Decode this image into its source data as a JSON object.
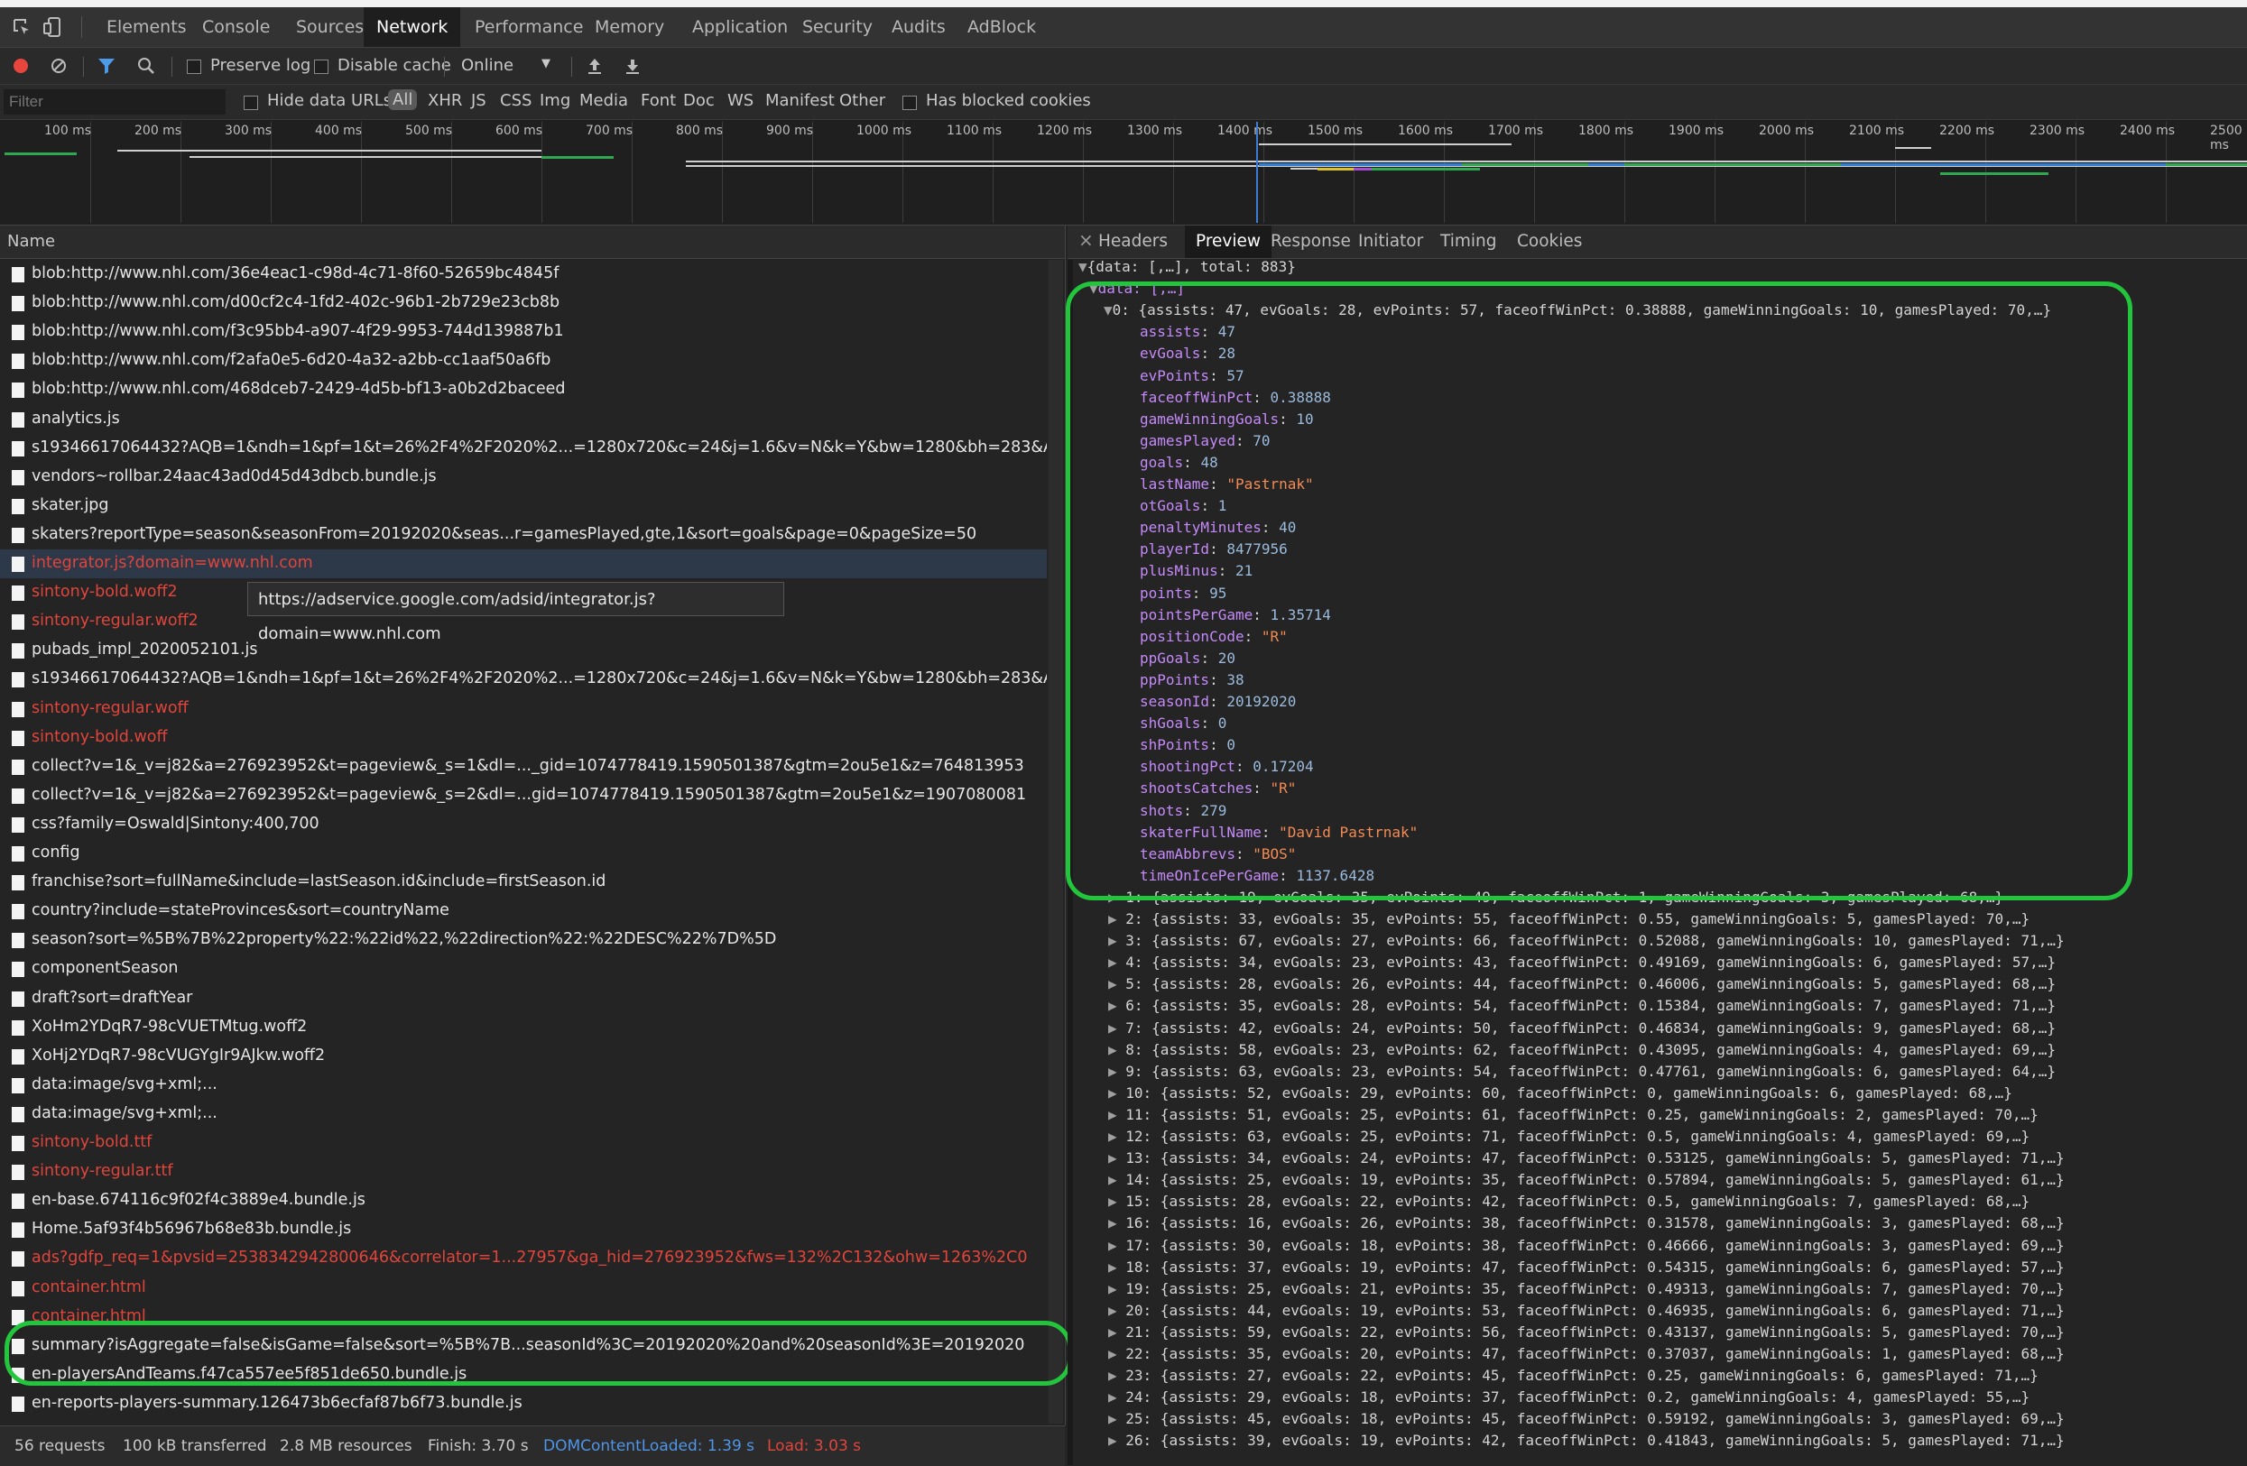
{
  "tabs": [
    "Elements",
    "Console",
    "Sources",
    "Network",
    "Performance",
    "Memory",
    "Application",
    "Security",
    "Audits",
    "AdBlock"
  ],
  "toolbar": {
    "preserve_log": "Preserve log",
    "disable_cache": "Disable cache",
    "throttle": "Online",
    "throttle_arrow": "▼"
  },
  "filterbar": {
    "placeholder": "Filter",
    "hide_data": "Hide data URLs",
    "types": [
      "All",
      "XHR",
      "JS",
      "CSS",
      "Img",
      "Media",
      "Font",
      "Doc",
      "WS",
      "Manifest",
      "Other"
    ],
    "blocked": "Has blocked cookies"
  },
  "timeline": [
    "100 ms",
    "200 ms",
    "300 ms",
    "400 ms",
    "500 ms",
    "600 ms",
    "700 ms",
    "800 ms",
    "900 ms",
    "1000 ms",
    "1100 ms",
    "1200 ms",
    "1300 ms",
    "1400 ms",
    "1500 ms",
    "1600 ms",
    "1700 ms",
    "1800 ms",
    "1900 ms",
    "2000 ms",
    "2100 ms",
    "2200 ms",
    "2300 ms",
    "2400 ms",
    "2500 ms"
  ],
  "list": {
    "header": "Name",
    "rows": [
      {
        "name": "blob:http://www.nhl.com/36e4eac1-c98d-4c71-8f60-52659bc4845f",
        "red": false
      },
      {
        "name": "blob:http://www.nhl.com/d00cf2c4-1fd2-402c-96b1-2b729e23cb8b",
        "red": false
      },
      {
        "name": "blob:http://www.nhl.com/f3c95bb4-a907-4f29-9953-744d139887b1",
        "red": false
      },
      {
        "name": "blob:http://www.nhl.com/f2afa0e5-6d20-4a32-a2bb-cc1aaf50a6fb",
        "red": false
      },
      {
        "name": "blob:http://www.nhl.com/468dceb7-2429-4d5b-bf13-a0b2d2baceed",
        "red": false
      },
      {
        "name": "analytics.js",
        "red": false
      },
      {
        "name": "s19346617064432?AQB=1&ndh=1&pf=1&t=26%2F4%2F2020%2...=1280x720&c=24&j=1.6&v=N&k=Y&bw=1280&bh=283&AQE=1",
        "red": false
      },
      {
        "name": "vendors~rollbar.24aac43ad0d45d43dbcb.bundle.js",
        "red": false
      },
      {
        "name": "skater.jpg",
        "red": false
      },
      {
        "name": "skaters?reportType=season&seasonFrom=20192020&seas...r=gamesPlayed,gte,1&sort=goals&page=0&pageSize=50",
        "red": false
      },
      {
        "name": "integrator.js?domain=www.nhl.com",
        "red": true
      },
      {
        "name": "sintony-bold.woff2",
        "red": true
      },
      {
        "name": "sintony-regular.woff2",
        "red": true
      },
      {
        "name": "pubads_impl_2020052101.js",
        "red": false
      },
      {
        "name": "s19346617064432?AQB=1&ndh=1&pf=1&t=26%2F4%2F2020%2...=1280x720&c=24&j=1.6&v=N&k=Y&bw=1280&bh=283&AQE=1",
        "red": false
      },
      {
        "name": "sintony-regular.woff",
        "red": true
      },
      {
        "name": "sintony-bold.woff",
        "red": true
      },
      {
        "name": "collect?v=1&_v=j82&a=276923952&t=pageview&_s=1&dl=..._gid=1074778419.1590501387&gtm=2ou5e1&z=764813953",
        "red": false
      },
      {
        "name": "collect?v=1&_v=j82&a=276923952&t=pageview&_s=2&dl=...gid=1074778419.1590501387&gtm=2ou5e1&z=1907080081",
        "red": false
      },
      {
        "name": "css?family=Oswald|Sintony:400,700",
        "red": false
      },
      {
        "name": "config",
        "red": false
      },
      {
        "name": "franchise?sort=fullName&include=lastSeason.id&include=firstSeason.id",
        "red": false
      },
      {
        "name": "country?include=stateProvinces&sort=countryName",
        "red": false
      },
      {
        "name": "season?sort=%5B%7B%22property%22:%22id%22,%22direction%22:%22DESC%22%7D%5D",
        "red": false
      },
      {
        "name": "componentSeason",
        "red": false
      },
      {
        "name": "draft?sort=draftYear",
        "red": false
      },
      {
        "name": "XoHm2YDqR7-98cVUETMtug.woff2",
        "red": false
      },
      {
        "name": "XoHj2YDqR7-98cVUGYgIr9AJkw.woff2",
        "red": false
      },
      {
        "name": "data:image/svg+xml;...",
        "red": false
      },
      {
        "name": "data:image/svg+xml;...",
        "red": false
      },
      {
        "name": "sintony-bold.ttf",
        "red": true
      },
      {
        "name": "sintony-regular.ttf",
        "red": true
      },
      {
        "name": "en-base.674116c9f02f4c3889e4.bundle.js",
        "red": false
      },
      {
        "name": "Home.5af93f4b56967b68e83b.bundle.js",
        "red": false
      },
      {
        "name": "ads?gdfp_req=1&pvsid=2538342942800646&correlator=1...27957&ga_hid=276923952&fws=132%2C132&ohw=1263%2C0",
        "red": true
      },
      {
        "name": "container.html",
        "red": true
      },
      {
        "name": "container.html",
        "red": true
      },
      {
        "name": "summary?isAggregate=false&isGame=false&sort=%5B%7B...seasonId%3C=20192020%20and%20seasonId%3E=20192020",
        "red": false
      },
      {
        "name": "en-playersAndTeams.f47ca557ee5f851de650.bundle.js",
        "red": false
      },
      {
        "name": "en-reports-players-summary.126473b6ecfaf87b6f73.bundle.js",
        "red": false
      }
    ]
  },
  "tooltip": "https://adservice.google.com/adsid/integrator.js?domain=www.nhl.com",
  "status": {
    "requests": "56 requests",
    "transferred": "100 kB transferred",
    "resources": "2.8 MB resources",
    "finish": "Finish: 3.70 s",
    "dcl": "DOMContentLoaded: 1.39 s",
    "load": "Load: 3.03 s"
  },
  "detail_tabs": [
    "Headers",
    "Preview",
    "Response",
    "Initiator",
    "Timing",
    "Cookies"
  ],
  "preview": {
    "root": "{data: [,…], total: 883}",
    "data_label": "data: [,…]",
    "item0_summary": "0: {assists: 47, evGoals: 28, evPoints: 57, faceoffWinPct: 0.38888, gameWinningGoals: 10, gamesPlayed: 70,…}",
    "fields": [
      {
        "k": "assists",
        "v": "47",
        "t": "n"
      },
      {
        "k": "evGoals",
        "v": "28",
        "t": "n"
      },
      {
        "k": "evPoints",
        "v": "57",
        "t": "n"
      },
      {
        "k": "faceoffWinPct",
        "v": "0.38888",
        "t": "n"
      },
      {
        "k": "gameWinningGoals",
        "v": "10",
        "t": "n"
      },
      {
        "k": "gamesPlayed",
        "v": "70",
        "t": "n"
      },
      {
        "k": "goals",
        "v": "48",
        "t": "n"
      },
      {
        "k": "lastName",
        "v": "\"Pastrnak\"",
        "t": "s"
      },
      {
        "k": "otGoals",
        "v": "1",
        "t": "n"
      },
      {
        "k": "penaltyMinutes",
        "v": "40",
        "t": "n"
      },
      {
        "k": "playerId",
        "v": "8477956",
        "t": "n"
      },
      {
        "k": "plusMinus",
        "v": "21",
        "t": "n"
      },
      {
        "k": "points",
        "v": "95",
        "t": "n"
      },
      {
        "k": "pointsPerGame",
        "v": "1.35714",
        "t": "n"
      },
      {
        "k": "positionCode",
        "v": "\"R\"",
        "t": "s"
      },
      {
        "k": "ppGoals",
        "v": "20",
        "t": "n"
      },
      {
        "k": "ppPoints",
        "v": "38",
        "t": "n"
      },
      {
        "k": "seasonId",
        "v": "20192020",
        "t": "n"
      },
      {
        "k": "shGoals",
        "v": "0",
        "t": "n"
      },
      {
        "k": "shPoints",
        "v": "0",
        "t": "n"
      },
      {
        "k": "shootingPct",
        "v": "0.17204",
        "t": "n"
      },
      {
        "k": "shootsCatches",
        "v": "\"R\"",
        "t": "s"
      },
      {
        "k": "shots",
        "v": "279",
        "t": "n"
      },
      {
        "k": "skaterFullName",
        "v": "\"David Pastrnak\"",
        "t": "s"
      },
      {
        "k": "teamAbbrevs",
        "v": "\"BOS\"",
        "t": "s"
      },
      {
        "k": "timeOnIcePerGame",
        "v": "1137.6428",
        "t": "n"
      }
    ],
    "items": [
      "1: {assists: 19, evGoals: 35, evPoints: 49, faceoffWinPct: 1, gameWinningGoals: 3, gamesPlayed: 68,…}",
      "2: {assists: 33, evGoals: 35, evPoints: 55, faceoffWinPct: 0.55, gameWinningGoals: 5, gamesPlayed: 70,…}",
      "3: {assists: 67, evGoals: 27, evPoints: 66, faceoffWinPct: 0.52088, gameWinningGoals: 10, gamesPlayed: 71,…}",
      "4: {assists: 34, evGoals: 23, evPoints: 43, faceoffWinPct: 0.49169, gameWinningGoals: 6, gamesPlayed: 57,…}",
      "5: {assists: 28, evGoals: 26, evPoints: 44, faceoffWinPct: 0.46006, gameWinningGoals: 5, gamesPlayed: 68,…}",
      "6: {assists: 35, evGoals: 28, evPoints: 54, faceoffWinPct: 0.15384, gameWinningGoals: 7, gamesPlayed: 71,…}",
      "7: {assists: 42, evGoals: 24, evPoints: 50, faceoffWinPct: 0.46834, gameWinningGoals: 9, gamesPlayed: 68,…}",
      "8: {assists: 58, evGoals: 23, evPoints: 62, faceoffWinPct: 0.43095, gameWinningGoals: 4, gamesPlayed: 69,…}",
      "9: {assists: 63, evGoals: 23, evPoints: 54, faceoffWinPct: 0.47761, gameWinningGoals: 6, gamesPlayed: 64,…}",
      "10: {assists: 52, evGoals: 29, evPoints: 60, faceoffWinPct: 0, gameWinningGoals: 6, gamesPlayed: 68,…}",
      "11: {assists: 51, evGoals: 25, evPoints: 61, faceoffWinPct: 0.25, gameWinningGoals: 2, gamesPlayed: 70,…}",
      "12: {assists: 63, evGoals: 25, evPoints: 71, faceoffWinPct: 0.5, gameWinningGoals: 4, gamesPlayed: 69,…}",
      "13: {assists: 34, evGoals: 24, evPoints: 47, faceoffWinPct: 0.53125, gameWinningGoals: 5, gamesPlayed: 71,…}",
      "14: {assists: 25, evGoals: 19, evPoints: 35, faceoffWinPct: 0.57894, gameWinningGoals: 5, gamesPlayed: 61,…}",
      "15: {assists: 28, evGoals: 22, evPoints: 42, faceoffWinPct: 0.5, gameWinningGoals: 7, gamesPlayed: 68,…}",
      "16: {assists: 16, evGoals: 26, evPoints: 38, faceoffWinPct: 0.31578, gameWinningGoals: 3, gamesPlayed: 68,…}",
      "17: {assists: 30, evGoals: 18, evPoints: 38, faceoffWinPct: 0.46666, gameWinningGoals: 3, gamesPlayed: 69,…}",
      "18: {assists: 37, evGoals: 19, evPoints: 47, faceoffWinPct: 0.54315, gameWinningGoals: 6, gamesPlayed: 57,…}",
      "19: {assists: 25, evGoals: 21, evPoints: 35, faceoffWinPct: 0.49313, gameWinningGoals: 7, gamesPlayed: 70,…}",
      "20: {assists: 44, evGoals: 19, evPoints: 53, faceoffWinPct: 0.46935, gameWinningGoals: 6, gamesPlayed: 71,…}",
      "21: {assists: 59, evGoals: 22, evPoints: 56, faceoffWinPct: 0.43137, gameWinningGoals: 5, gamesPlayed: 70,…}",
      "22: {assists: 35, evGoals: 20, evPoints: 47, faceoffWinPct: 0.37037, gameWinningGoals: 1, gamesPlayed: 68,…}",
      "23: {assists: 27, evGoals: 22, evPoints: 45, faceoffWinPct: 0.25, gameWinningGoals: 6, gamesPlayed: 71,…}",
      "24: {assists: 29, evGoals: 18, evPoints: 37, faceoffWinPct: 0.2, gameWinningGoals: 4, gamesPlayed: 55,…}",
      "25: {assists: 45, evGoals: 18, evPoints: 45, faceoffWinPct: 0.59192, gameWinningGoals: 3, gamesPlayed: 69,…}",
      "26: {assists: 39, evGoals: 19, evPoints: 42, faceoffWinPct: 0.41843, gameWinningGoals: 5, gamesPlayed: 71,…}"
    ]
  }
}
